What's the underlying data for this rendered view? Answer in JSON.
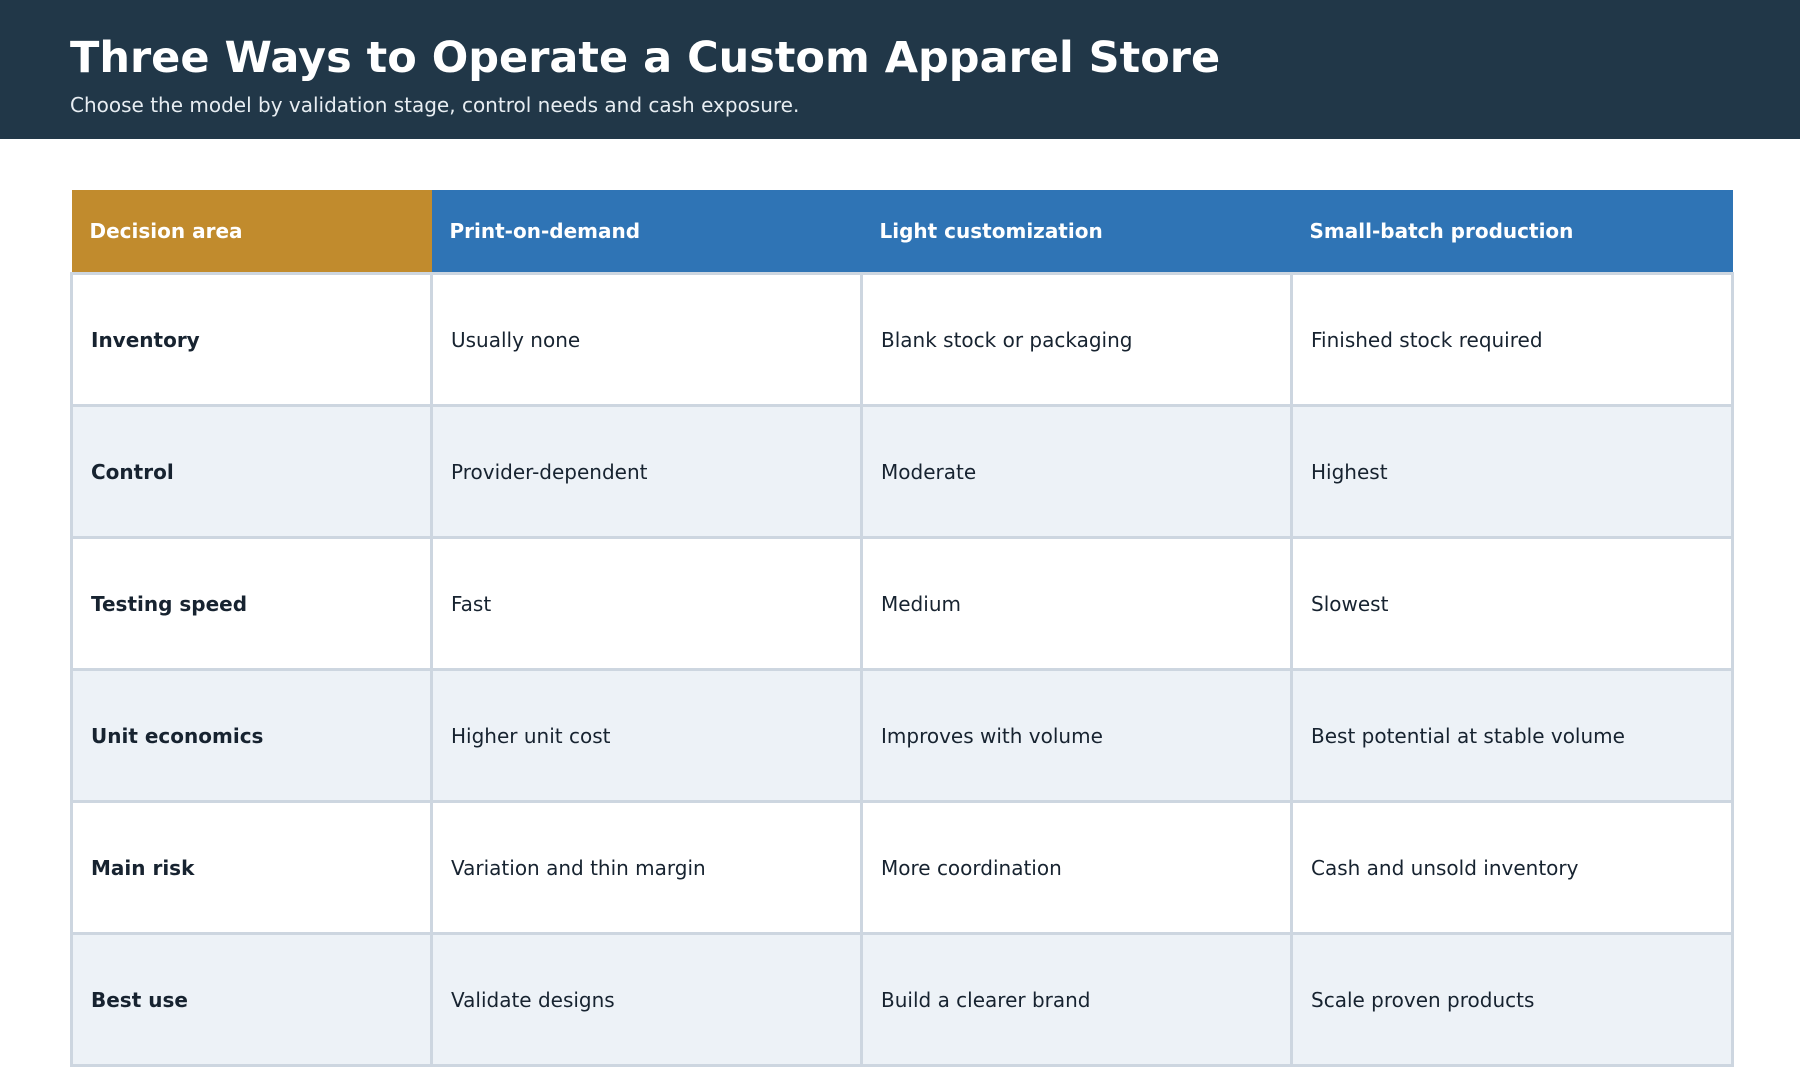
{
  "header": {
    "title": "Three Ways to Operate a Custom Apparel Store",
    "subtitle": "Choose the model by validation stage, control needs and cash exposure.",
    "background_color": "#213748"
  },
  "table": {
    "columns": [
      "Decision area",
      "Print-on-demand",
      "Light customization",
      "Small-batch production"
    ],
    "rows": [
      [
        "Inventory",
        "Usually none",
        "Blank stock or packaging",
        "Finished stock required"
      ],
      [
        "Control",
        "Provider-dependent",
        "Moderate",
        "Highest"
      ],
      [
        "Testing speed",
        "Fast",
        "Medium",
        "Slowest"
      ],
      [
        "Unit economics",
        "Higher unit cost",
        "Improves with volume",
        "Best potential at stable volume"
      ],
      [
        "Main risk",
        "Variation and thin margin",
        "More coordination",
        "Cash and unsold inventory"
      ],
      [
        "Best use",
        "Validate designs",
        "Build a clearer brand",
        "Scale proven products"
      ]
    ],
    "colors": {
      "first_header": "#c18b2d",
      "header": "#2f74b5",
      "alt_row": "#edf2f7",
      "border": "#cdd6e0"
    }
  }
}
